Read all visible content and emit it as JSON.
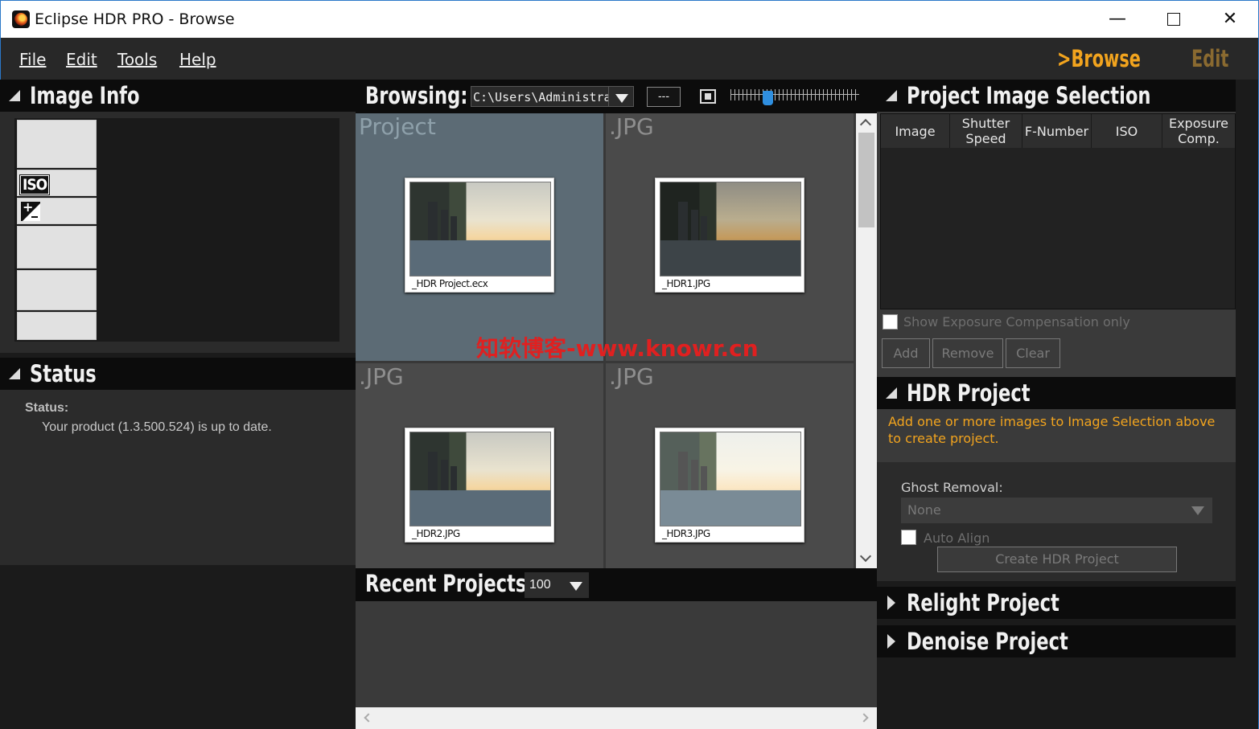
{
  "window": {
    "title": "Eclipse HDR PRO - Browse"
  },
  "menu": {
    "file": "File",
    "edit": "Edit",
    "tools": "Tools",
    "help": "Help",
    "mode_browse": ">Browse",
    "mode_edit": "Edit"
  },
  "image_info": {
    "title": "Image Info",
    "iso_icon": "ISO",
    "ev_icon": "exposure-compensation-icon"
  },
  "status": {
    "title": "Status",
    "label": "Status:",
    "text": "Your product (1.3.500.524) is up to date."
  },
  "browser": {
    "label": "Browsing:",
    "path": "C:\\Users\\Administrator\\Pictures",
    "browse_button": "---",
    "thumb_size_slider": 0.27,
    "items": [
      {
        "type": "Project",
        "name": "_HDR Project.ecx",
        "selected": true
      },
      {
        "type": ".JPG",
        "name": "_HDR1.JPG",
        "selected": false
      },
      {
        "type": ".JPG",
        "name": "_HDR2.JPG",
        "selected": false
      },
      {
        "type": ".JPG",
        "name": "_HDR3.JPG",
        "selected": false
      }
    ]
  },
  "recent": {
    "label": "Recent Projects:",
    "count": "100"
  },
  "selection": {
    "title": "Project Image Selection",
    "columns": {
      "image": "Image",
      "shutter": "Shutter Speed",
      "fnumber": "F-Number",
      "iso": "ISO",
      "exposure": "Exposure Comp."
    },
    "show_exposure_only": "Show Exposure Compensation only",
    "add": "Add",
    "remove": "Remove",
    "clear": "Clear"
  },
  "hdr_project": {
    "title": "HDR Project",
    "message": "Add one or more images to Image Selection above to create project.",
    "ghost_label": "Ghost Removal:",
    "ghost_value": "None",
    "auto_align": "Auto Align",
    "create_button": "Create HDR Project"
  },
  "relight": {
    "title": "Relight Project"
  },
  "denoise": {
    "title": "Denoise Project"
  },
  "watermark": "知软博客-www.knowr.cn"
}
